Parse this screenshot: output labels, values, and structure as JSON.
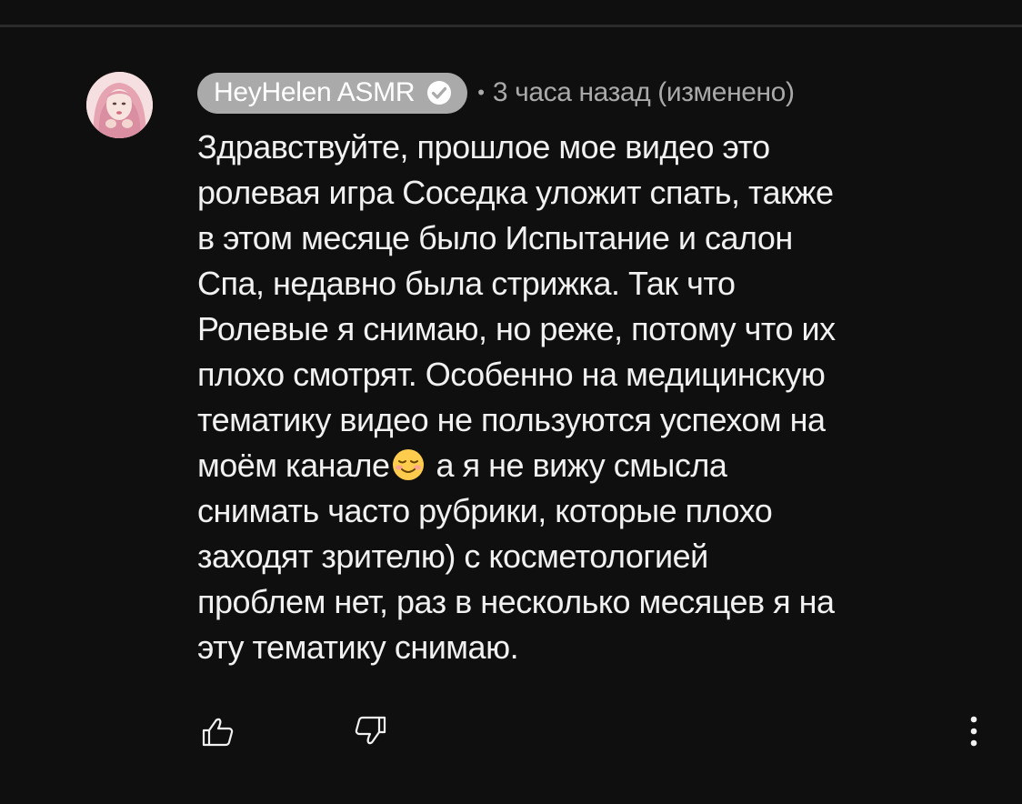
{
  "comment": {
    "author": "HeyHelen ASMR",
    "verified_icon": "verified-check-icon",
    "separator": "•",
    "timestamp": "3 часа назад (изменено)",
    "lines": [
      "Здравствуйте, прошлое мое видео это",
      "ролевая игра Соседка уложит спать, также",
      "в этом месяце было Испытание и салон",
      "Спа, недавно была стрижка. Так что",
      "Ролевые я снимаю, но реже, потому что их",
      "плохо смотрят. Особенно на медицинскую",
      "тематику видео не пользуются успехом на"
    ],
    "line8_before_emoji": "моём канале",
    "emoji": "☺️",
    "line8_after_emoji": "а я не вижу смысла",
    "lines_after": [
      "снимать часто рубрики, которые плохо",
      "заходят зрителю) с косметологией",
      "проблем нет, раз в несколько месяцев я на",
      "эту тематику снимаю."
    ]
  },
  "actions": {
    "like_icon": "thumbs-up-icon",
    "dislike_icon": "thumbs-down-icon",
    "more_icon": "more-vertical-icon"
  },
  "colors": {
    "background": "#0f0f0f",
    "text": "#f1f1f1",
    "secondary_text": "#aaaaaa",
    "author_chip": "#aaaaaa"
  }
}
